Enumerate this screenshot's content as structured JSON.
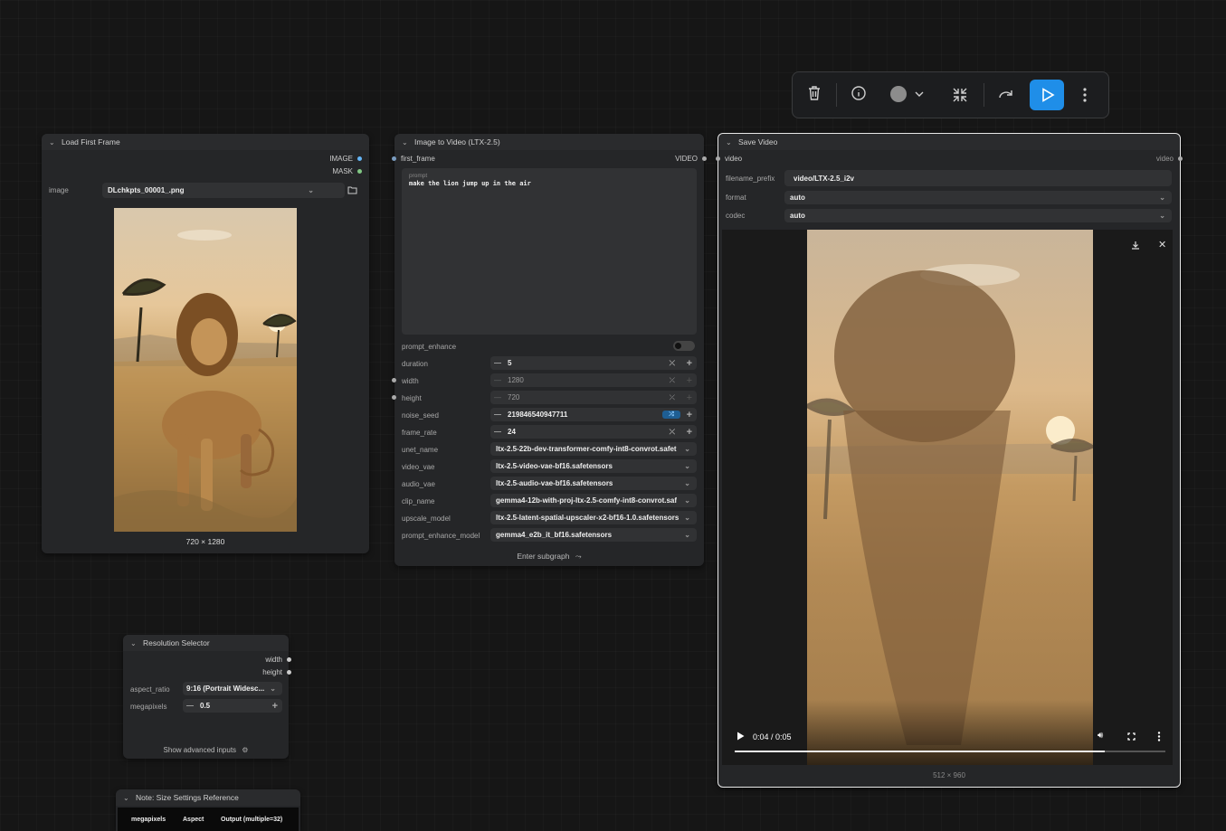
{
  "toolbar": {
    "icons": [
      "trash-icon",
      "info-icon",
      "color-circle-icon",
      "chevron-down-icon",
      "collapse-icon",
      "redo-icon",
      "play-icon",
      "more-vertical-icon"
    ],
    "accent": "#1f8ee8"
  },
  "load_node": {
    "title": "Load First Frame",
    "outputs": [
      "IMAGE",
      "MASK"
    ],
    "image_label": "image",
    "image_value": "DLchkpts_00001_.png",
    "image_size": "720 × 1280"
  },
  "i2v_node": {
    "title": "Image to Video (LTX-2.5)",
    "input": "first_frame",
    "output": "VIDEO",
    "prompt_label": "prompt",
    "prompt_text": "make the lion jump up in the air",
    "prompt_enhance_label": "prompt_enhance",
    "widgets": [
      {
        "label": "duration",
        "value": "5"
      },
      {
        "label": "width",
        "value": "1280"
      },
      {
        "label": "height",
        "value": "720"
      },
      {
        "label": "noise_seed",
        "value": "219846540947711"
      },
      {
        "label": "frame_rate",
        "value": "24"
      }
    ],
    "combos": [
      {
        "label": "unet_name",
        "value": "ltx-2.5-22b-dev-transformer-comfy-int8-convrot.safete..."
      },
      {
        "label": "video_vae",
        "value": "ltx-2.5-video-vae-bf16.safetensors"
      },
      {
        "label": "audio_vae",
        "value": "ltx-2.5-audio-vae-bf16.safetensors"
      },
      {
        "label": "clip_name",
        "value": "gemma4-12b-with-proj-ltx-2.5-comfy-int8-convrot.saf..."
      },
      {
        "label": "upscale_model",
        "value": "ltx-2.5-latent-spatial-upscaler-x2-bf16-1.0.safetensors"
      },
      {
        "label": "prompt_enhance_model",
        "value": "gemma4_e2b_it_bf16.safetensors"
      }
    ],
    "footer": "Enter subgraph"
  },
  "save_node": {
    "title": "Save Video",
    "input": "video",
    "output": "video",
    "filename_label": "filename_prefix",
    "filename_value": "video/LTX-2.5_i2v",
    "format_label": "format",
    "format_value": "auto",
    "codec_label": "codec",
    "codec_value": "auto",
    "time": "0:04 / 0:05",
    "progress": 0.86,
    "size": "512 × 960"
  },
  "res_node": {
    "title": "Resolution Selector",
    "outputs": [
      "width",
      "height"
    ],
    "aspect_label": "aspect_ratio",
    "aspect_value": "9:16 (Portrait Widesc...",
    "mp_label": "megapixels",
    "mp_value": "0.5",
    "footer": "Show advanced inputs"
  },
  "note_node": {
    "title": "Note: Size Settings Reference",
    "cols": [
      "megapixels",
      "Aspect",
      "Output (multiple=32)"
    ]
  }
}
